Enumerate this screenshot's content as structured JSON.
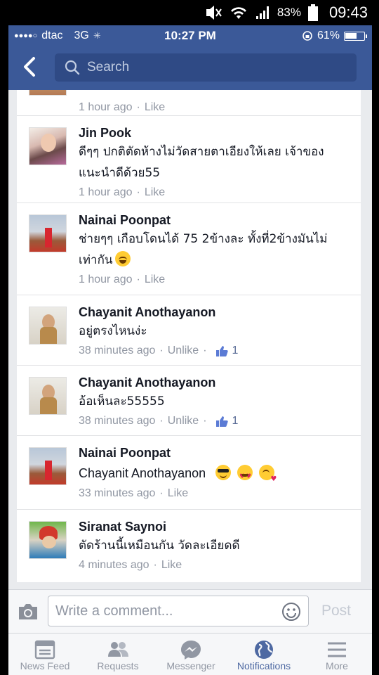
{
  "android_status": {
    "battery_percent": "83%",
    "time": "09:43"
  },
  "ios_status": {
    "carrier": "dtac",
    "network": "3G",
    "time": "10:27 PM",
    "battery": "61%",
    "battery_level": 0.61
  },
  "header": {
    "search_placeholder": "Search"
  },
  "comments": [
    {
      "author": "",
      "text": "",
      "time": "1 hour ago",
      "action": "Like",
      "likes": ""
    },
    {
      "author": "Jin Pook",
      "text_lines": [
        "ดีๆๆ ปกติตัดห้างไม่วัดสายตาเอียงให้เลย เจ้าของ",
        "แนะนำดีด้วย55"
      ],
      "time": "1 hour ago",
      "action": "Like"
    },
    {
      "author": "Nainai Poonpat",
      "text_lines": [
        "ช่ายๆๆ เกือบโดนได้ 75 2ข้างละ ทั้งที่2ข้างมันไม่",
        "เท่ากัน"
      ],
      "time": "1 hour ago",
      "action": "Like"
    },
    {
      "author": "Chayanit Anothayanon",
      "text_lines": [
        "อยู่ตรงไหนง่ะ"
      ],
      "time": "38 minutes ago",
      "action": "Unlike",
      "likes": "1"
    },
    {
      "author": "Chayanit Anothayanon",
      "text_lines": [
        "อ้อเห็นละ55555"
      ],
      "time": "38 minutes ago",
      "action": "Unlike",
      "likes": "1"
    },
    {
      "author": "Nainai Poonpat",
      "text_lines": [
        "Chayanit Anothayanon"
      ],
      "time": "33 minutes ago",
      "action": "Like"
    },
    {
      "author": "Siranat Saynoi",
      "text_lines": [
        "ตัดร้านนี้เหมือนกัน วัดละเอียดดี"
      ],
      "time": "4 minutes ago",
      "action": "Like"
    }
  ],
  "composer": {
    "placeholder": "Write a comment...",
    "post_label": "Post"
  },
  "tabs": [
    {
      "label": "News Feed",
      "icon": "news-feed-icon"
    },
    {
      "label": "Requests",
      "icon": "requests-icon"
    },
    {
      "label": "Messenger",
      "icon": "messenger-icon"
    },
    {
      "label": "Notifications",
      "icon": "notifications-globe-icon",
      "active": true
    },
    {
      "label": "More",
      "icon": "more-menu-icon"
    }
  ],
  "colors": {
    "brand_blue": "#3b5998",
    "meta_gray": "#9197a3",
    "active_tab": "#4e69a2"
  }
}
